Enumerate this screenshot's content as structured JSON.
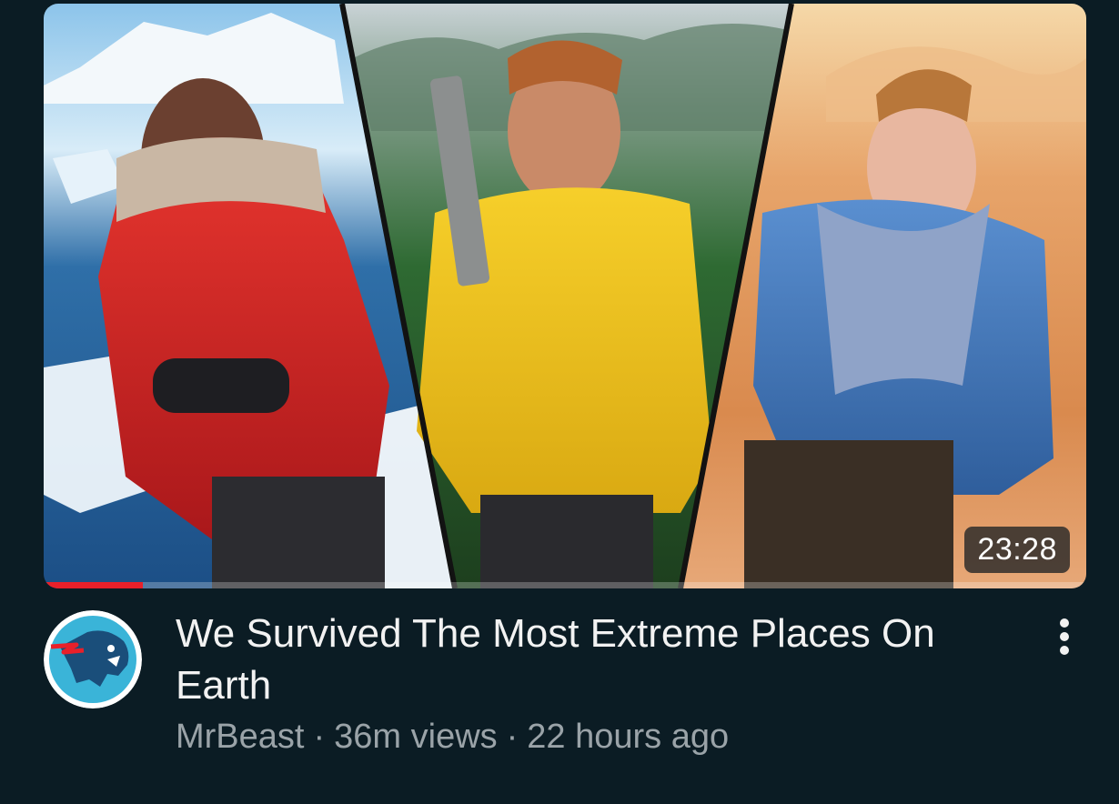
{
  "video": {
    "duration": "23:28",
    "watch_progress": 0.095,
    "title": "We Survived The Most Extreme Places On Earth",
    "channel": "MrBeast",
    "views": "36m views",
    "age": "22 hours ago",
    "separator": "·"
  },
  "colors": {
    "background": "#0b1c24",
    "progress": "#e8202a",
    "title_text": "#f2f2f2",
    "meta_text": "#9aa3a8",
    "avatar_bg": "#3ab4d8"
  },
  "icons": {
    "more": "more-vert-icon",
    "avatar": "channel-logo-panther"
  }
}
